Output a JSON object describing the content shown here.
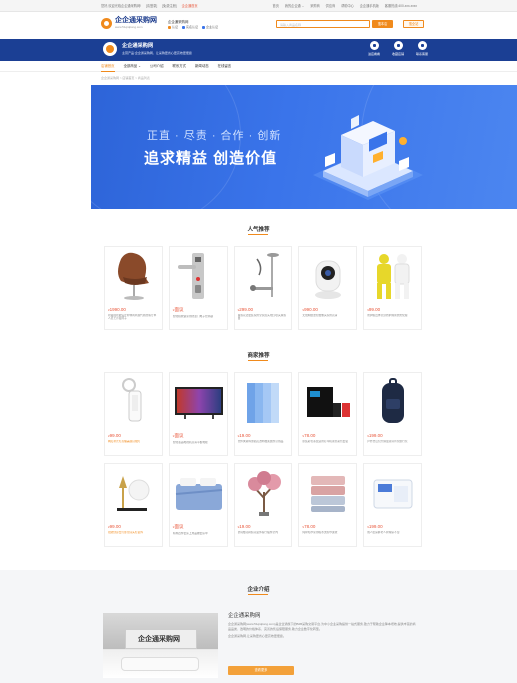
{
  "colors": {
    "brand_blue": "#1b3f94",
    "accent_orange": "#f08a1c",
    "price_red": "#e8563a",
    "hero_blue": "#3a74ea"
  },
  "topbar": {
    "left": [
      "您好,欢迎光临企企通采购网!",
      "[请登录]",
      "[免费注册]"
    ],
    "hot": "企企通首页",
    "right": [
      "首页",
      "我的企企通 ⌄",
      "采购商",
      "供应商",
      "帮助中心",
      "企企通手机版",
      "客服热线:400-xxx-xxxx"
    ]
  },
  "header": {
    "logo_title": "企企通采购网",
    "logo_url": "www.51qiqitong.com",
    "company": "企企通采购网",
    "badges": [
      "认证",
      "实名认证",
      "企业认证"
    ],
    "search_placeholder": "请输入商品名称",
    "search_button": "搜本店",
    "post_button": "搜全站"
  },
  "shop": {
    "name": "企企通采购网",
    "desc": "主营产品:企企通采购网、让采购更省心更高效更便捷",
    "actions": [
      {
        "label": "进店看看",
        "icon": "store-icon"
      },
      {
        "label": "收藏店铺",
        "icon": "star-icon"
      },
      {
        "label": "联系客服",
        "icon": "chat-icon"
      }
    ]
  },
  "nav": {
    "items": [
      "店铺首页",
      "全部商品 ⌄",
      "公司介绍",
      "联系方式",
      "新闻动态",
      "在线留言"
    ]
  },
  "breadcrumb": "企企通采购网 > 店铺首页 > 商品列表",
  "hero": {
    "small": "正直 · 尽责 · 合作 · 创新",
    "big": "追求精益  创造价值"
  },
  "popular": {
    "title": "人气推荐",
    "items": [
      {
        "price": "1990.00",
        "desc": "鸡蛋椅北欧设计师休闲椅现代简约客厅单人皮艺沙发椅子",
        "icon": "chair-icon",
        "desc_style": ""
      },
      {
        "price": "面议",
        "desc": "智能指纹锁家用防盗门电子密码锁",
        "icon": "door-lock-icon",
        "desc_style": ""
      },
      {
        "price": "299.00",
        "desc": "淋浴花洒套装家用全铜龙头增压喷头淋浴器",
        "icon": "shower-icon",
        "desc_style": ""
      },
      {
        "price": "990.00",
        "desc": "无线网络监控摄像头家用高清",
        "icon": "camera-icon",
        "desc_style": ""
      },
      {
        "price": "99.00",
        "desc": "防护服连体全身防护隔离衣防化服",
        "icon": "protective-suit-icon",
        "desc_style": ""
      }
    ]
  },
  "merchant": {
    "title": "商家推荐",
    "items": [
      {
        "price": "99.00",
        "desc": "网红补光灯直播美颜自拍灯",
        "icon": "ring-light-icon",
        "desc_style": "orange"
      },
      {
        "price": "面议",
        "desc": "智能液晶电视机高清平板电视",
        "icon": "tv-icon",
        "desc_style": ""
      },
      {
        "price": "19.00",
        "desc": "文件夹资料册插页透明档案袋办公用品",
        "icon": "folder-icon",
        "desc_style": ""
      },
      {
        "price": "78.00",
        "desc": "原装彩色墨盒适用打印机黑色彩色套装",
        "icon": "ink-cartridge-icon",
        "desc_style": ""
      },
      {
        "price": "199.00",
        "desc": "户外登山包大容量双肩背包旅行包",
        "icon": "backpack-icon",
        "desc_style": ""
      },
      {
        "price": "99.00",
        "desc": "北欧创意台灯卧室床头灯装饰",
        "icon": "lamp-icon",
        "desc_style": "orange"
      },
      {
        "price": "面议",
        "desc": "纯棉四件套床上用品被套床单",
        "icon": "bedding-icon",
        "desc_style": ""
      },
      {
        "price": "19.00",
        "desc": "仿真樱花树假花装饰客厅摆件室内",
        "icon": "tree-icon",
        "desc_style": ""
      },
      {
        "price": "78.00",
        "desc": "纯棉毛巾家用吸水洗脸巾柔软",
        "icon": "towel-icon",
        "desc_style": ""
      },
      {
        "price": "199.00",
        "desc": "成人纸尿裤老人护理尿不湿",
        "icon": "diaper-icon",
        "desc_style": ""
      }
    ]
  },
  "company": {
    "title": "企业介绍",
    "name": "企企通采购网",
    "sign": "企企通采购网",
    "text1": "企企通采购网(www.51qiqitong.com)是企企通旗下的B2B采购交易平台,为中小企业采购提供一站式服务,致力于帮助企业降本增效,提供丰富的商品品类、透明的价格体系、完善的售后保障服务,助力企业数字化转型。",
    "text2": "企企通采购网,让采购更省心更高效更便捷。",
    "button": "查看更多"
  }
}
